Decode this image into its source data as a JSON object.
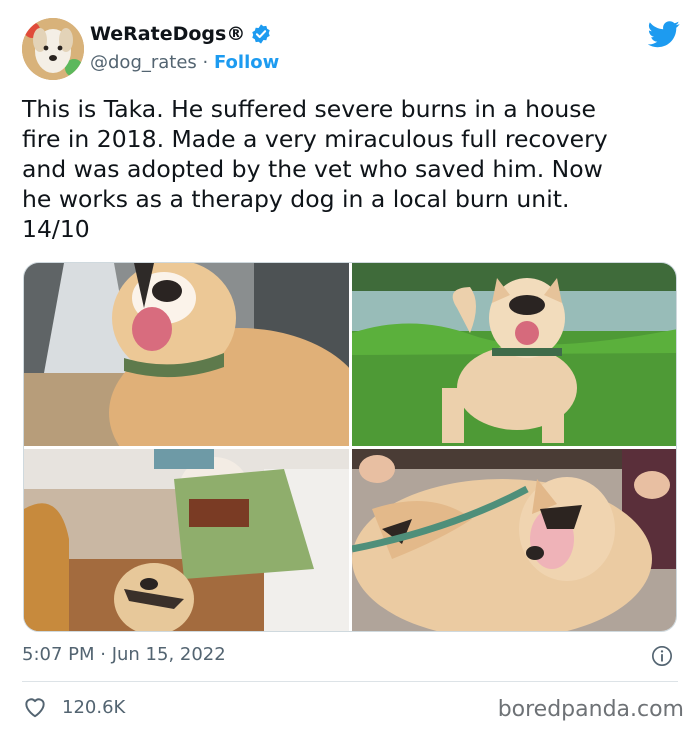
{
  "account": {
    "display_name": "WeRateDogs®",
    "handle": "@dog_rates",
    "separator": " · ",
    "follow_label": "Follow"
  },
  "tweet": {
    "text": "This is Taka. He suffered severe burns in a house\nfire in 2018. Made a very miraculous full recovery\nand was adopted by the vet who saved him. Now\nhe works as a therapy dog in a local burn unit.\n14/10"
  },
  "meta": {
    "timestamp": "5:07 PM · Jun 15, 2022"
  },
  "engagement": {
    "likes": "120.6K"
  },
  "watermark": "boredpanda.com",
  "icons": {
    "verified": "verified-badge-icon",
    "twitter": "twitter-bird-icon",
    "info": "info-icon",
    "like": "heart-icon"
  },
  "colors": {
    "accent": "#1d9bf0",
    "text": "#0f1419",
    "muted": "#536471"
  }
}
